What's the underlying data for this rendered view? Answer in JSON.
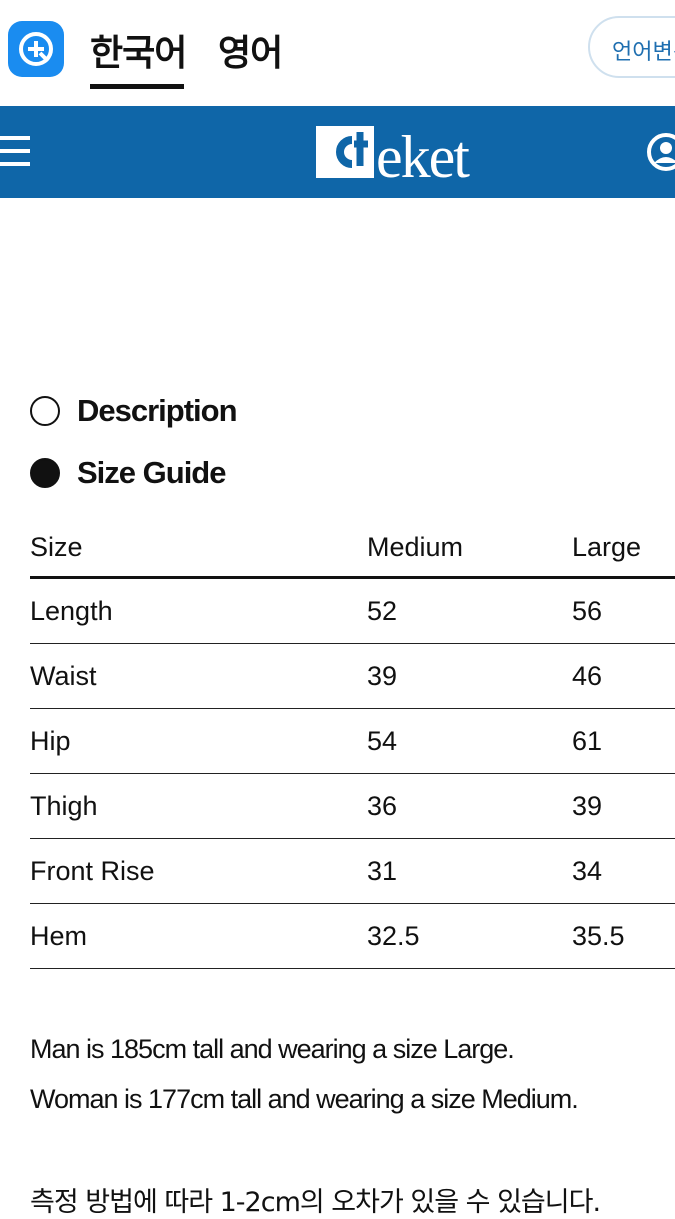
{
  "langbar": {
    "tabs": [
      "한국어",
      "영어"
    ],
    "active_tab": "한국어",
    "lang_button": "언어변경"
  },
  "header": {
    "logo": "cteket",
    "bg_color": "#0f66a8"
  },
  "sections": {
    "description": "Description",
    "size_guide": "Size Guide"
  },
  "size_table": {
    "headers": [
      "Size",
      "Medium",
      "Large"
    ],
    "rows": [
      [
        "Length",
        "52",
        "56"
      ],
      [
        "Waist",
        "39",
        "46"
      ],
      [
        "Hip",
        "54",
        "61"
      ],
      [
        "Thigh",
        "36",
        "39"
      ],
      [
        "Front Rise",
        "31",
        "34"
      ],
      [
        "Hem",
        "32.5",
        "35.5"
      ]
    ]
  },
  "notes": {
    "man": "Man is 185cm tall and wearing a size Large.",
    "woman": "Woman is 177cm tall and wearing a size Medium.",
    "ko": "측정 방법에 따라 1-2cm의 오차가 있을 수 있습니다."
  }
}
